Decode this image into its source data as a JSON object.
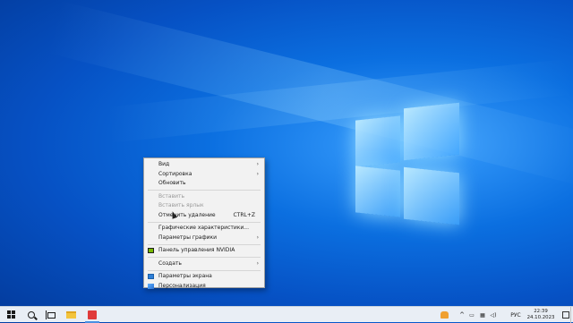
{
  "context_menu": {
    "items": [
      {
        "label": "Вид"
      },
      {
        "label": "Сортировка"
      },
      {
        "label": "Обновить"
      },
      {
        "label": "Вставить"
      },
      {
        "label": "Вставить ярлык"
      },
      {
        "label": "Отменить удаление",
        "shortcut": "CTRL+Z"
      },
      {
        "label": "Графические характеристики..."
      },
      {
        "label": "Параметры графики"
      },
      {
        "label": "Панель управления NVIDIA"
      },
      {
        "label": "Создать"
      },
      {
        "label": "Параметры экрана"
      },
      {
        "label": "Персонализация"
      }
    ]
  },
  "taskbar": {
    "language": "РУС",
    "time": "22:39",
    "date": "24.10.2023",
    "icons": [
      "start-icon",
      "search-icon",
      "task-view-icon",
      "file-explorer-icon",
      "app-icon",
      "user-icon",
      "chevron-up-icon",
      "battery-icon",
      "network-icon",
      "volume-icon",
      "notification-icon"
    ]
  },
  "colors": {
    "desktop_blue": "#0b6fe0",
    "menu_bg": "#f2f2f2",
    "taskbar_bg": "#e9eef5",
    "nvidia_green": "#76b900"
  }
}
